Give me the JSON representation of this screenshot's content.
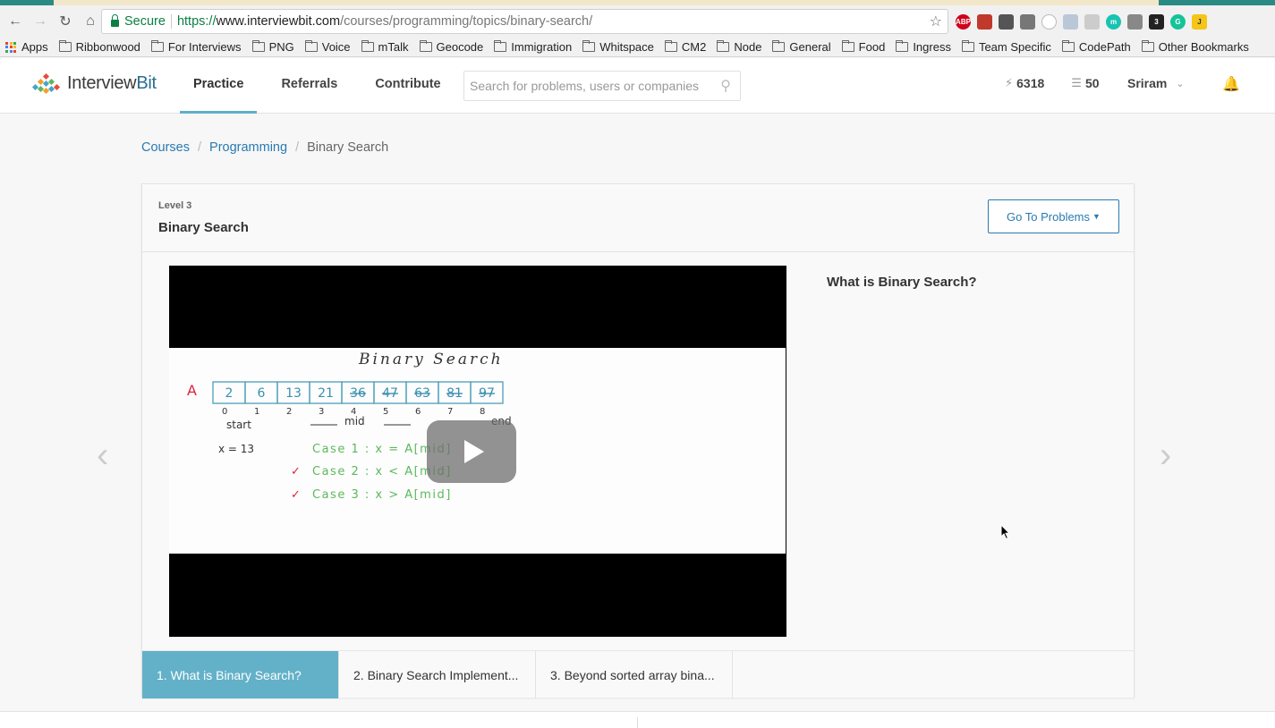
{
  "browser": {
    "secure_label": "Secure",
    "url_scheme": "https://",
    "url_host": "www.interviewbit.com",
    "url_path": "/courses/programming/topics/binary-search/"
  },
  "bookmarks": [
    "Apps",
    "Ribbonwood",
    "For Interviews",
    "PNG",
    "Voice",
    "mTalk",
    "Geocode",
    "Immigration",
    "Whitspace",
    "CM2",
    "Node",
    "General",
    "Food",
    "Ingress",
    "Team Specific",
    "CodePath",
    "Other Bookmarks"
  ],
  "header": {
    "logo_text_a": "Interview",
    "logo_text_b": "Bit",
    "nav": [
      "Practice",
      "Referrals",
      "Contribute"
    ],
    "search_placeholder": "Search for problems, users or companies",
    "score": "6318",
    "coins": "50",
    "user": "Sriram"
  },
  "breadcrumb": [
    "Courses",
    "Programming",
    "Binary Search"
  ],
  "topic": {
    "level": "Level 3",
    "title": "Binary Search",
    "goto_label": "Go To Problems",
    "side_title": "What is Binary Search?"
  },
  "video": {
    "title": "Binary Search",
    "array_label": "A",
    "array": [
      "2",
      "6",
      "13",
      "21",
      "36",
      "47",
      "63",
      "81",
      "97"
    ],
    "indices": [
      "0",
      "1",
      "2",
      "3",
      "4",
      "5",
      "6",
      "7",
      "8"
    ],
    "start_label": "start",
    "mid_label": "mid",
    "end_label": "end",
    "x_label": "x = 13",
    "cases": [
      "Case 1 :   x = A[mid]",
      "Case 2 :   x < A[mid]",
      "Case 3 :   x > A[mid]"
    ]
  },
  "tabs": [
    "1. What is Binary Search?",
    "2. Binary Search Implement...",
    "3. Beyond sorted array bina..."
  ],
  "colors": {
    "accent": "#63b1c8",
    "link": "#2a7ab0",
    "secure": "#0b8043"
  }
}
